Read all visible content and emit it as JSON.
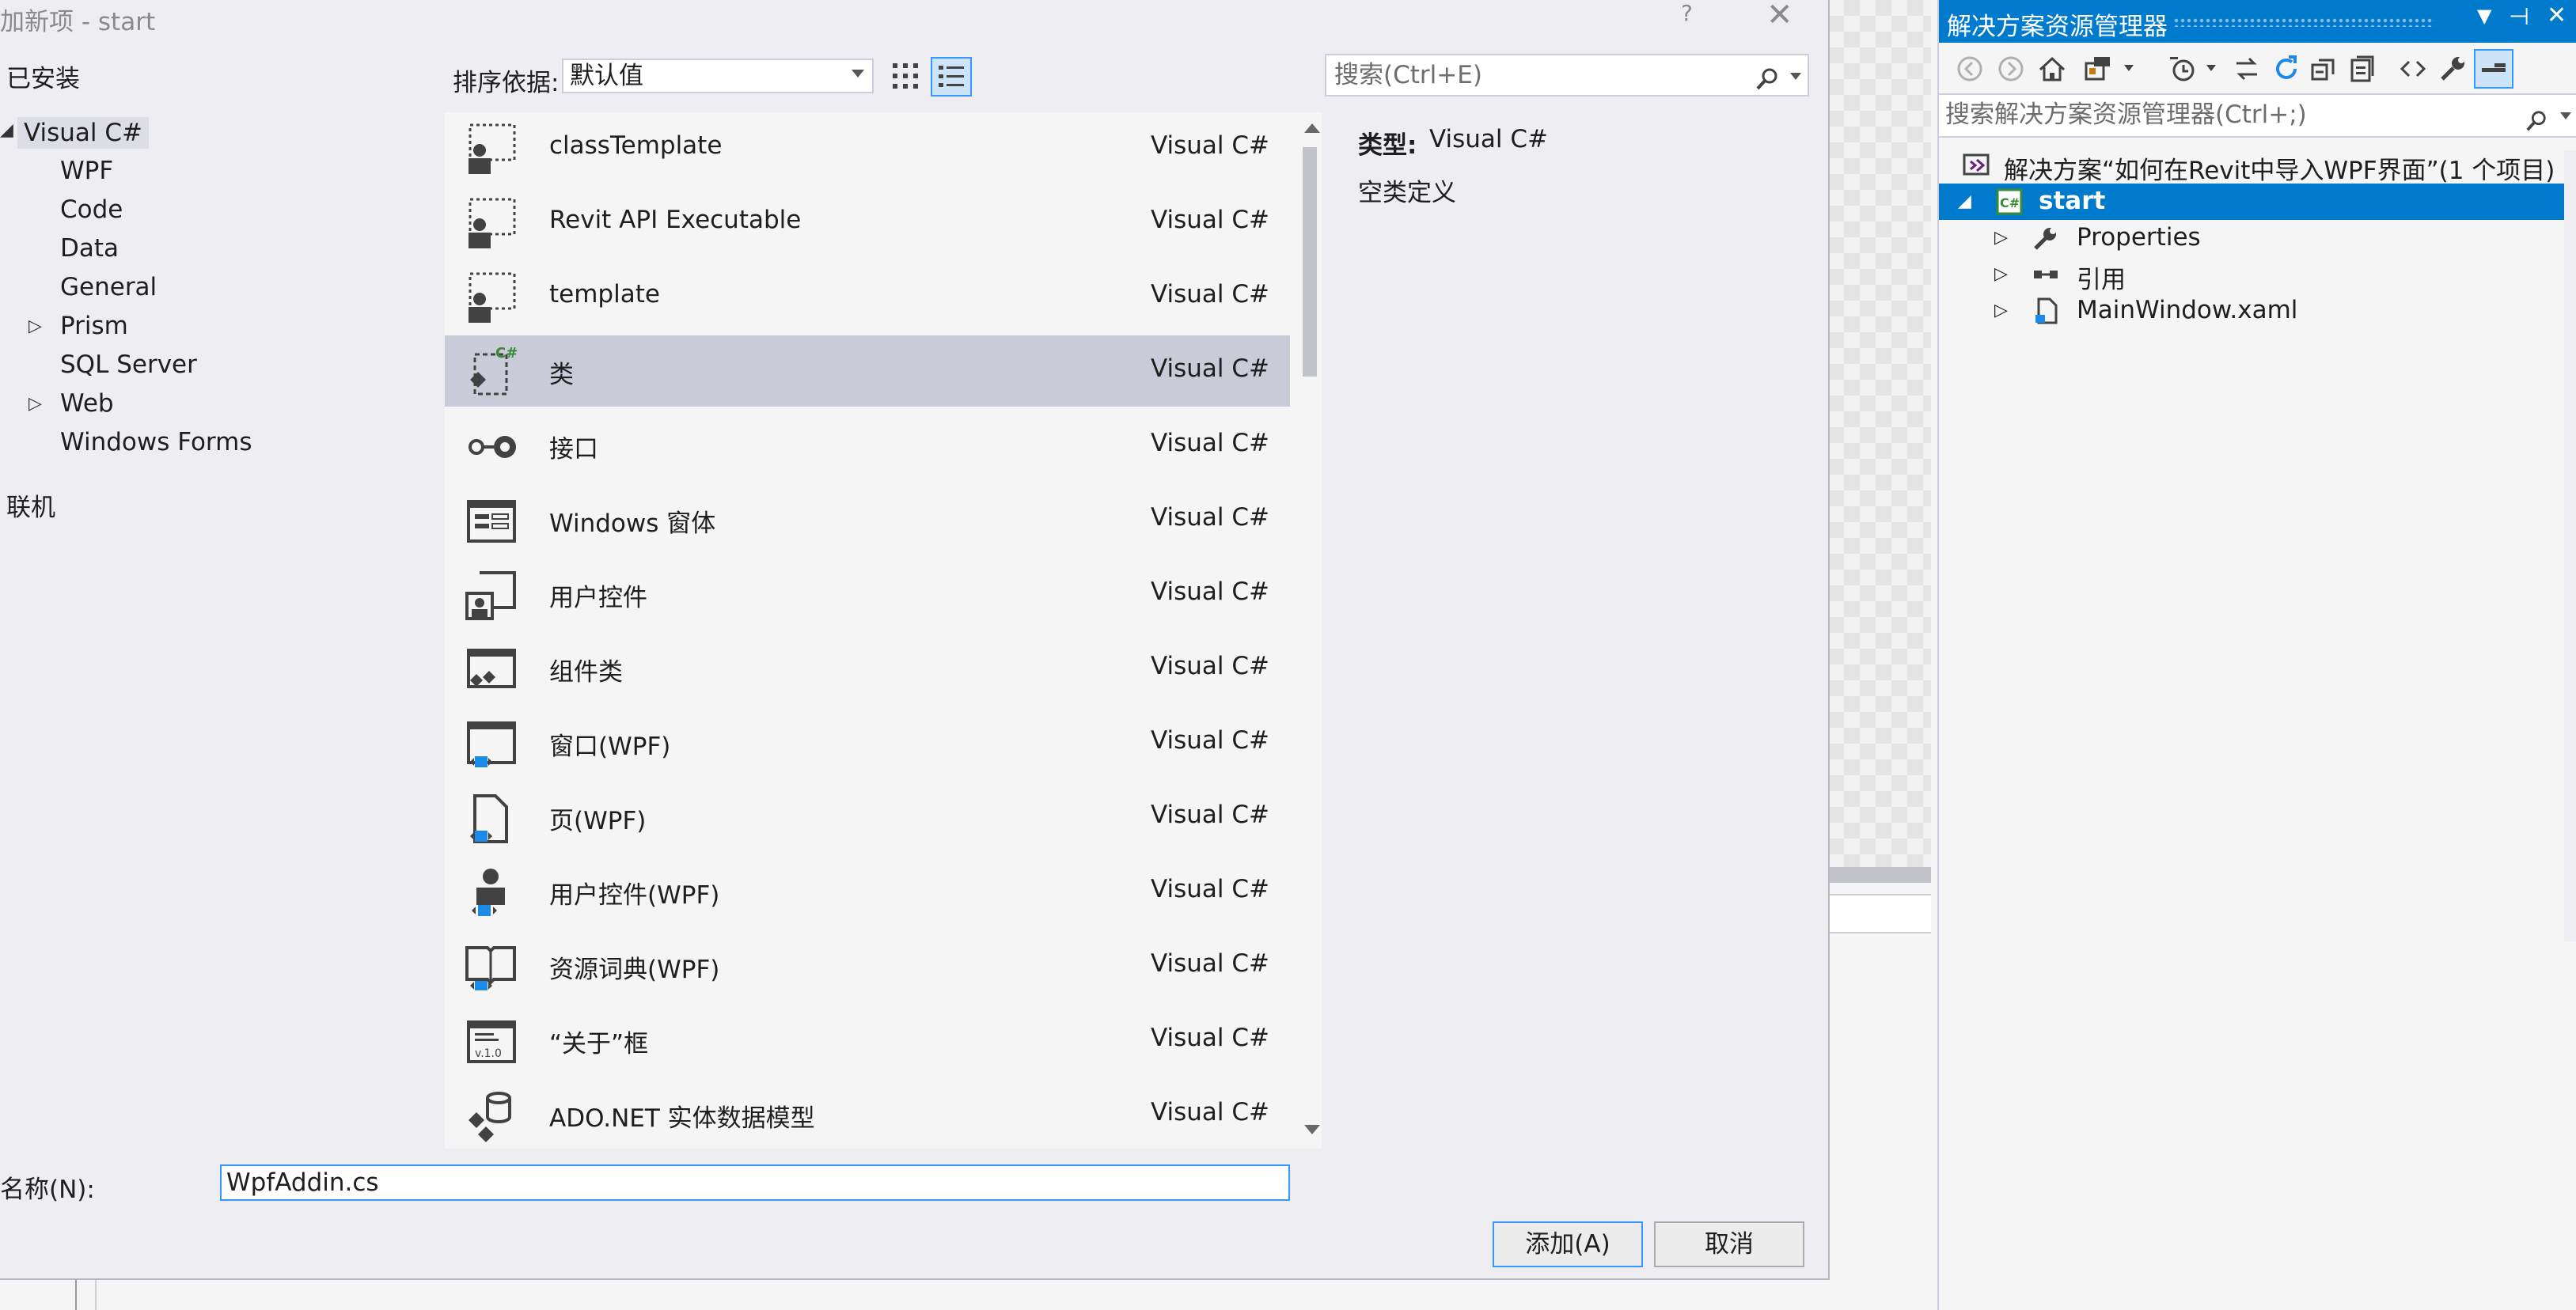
{
  "dialog": {
    "title": "加新项 - start",
    "help": "?",
    "close": "✕",
    "installed": "已安装",
    "tree": {
      "root": "Visual C#",
      "items": [
        "WPF",
        "Code",
        "Data",
        "General",
        "Prism",
        "SQL Server",
        "Web",
        "Windows Forms"
      ],
      "online": "联机"
    },
    "sort_label": "排序依据:",
    "sort_value": "默认值",
    "search_placeholder": "搜索(Ctrl+E)",
    "templates": [
      {
        "name": "classTemplate",
        "type": "Visual C#"
      },
      {
        "name": "Revit API Executable",
        "type": "Visual C#"
      },
      {
        "name": "template",
        "type": "Visual C#"
      },
      {
        "name": "类",
        "type": "Visual C#"
      },
      {
        "name": "接口",
        "type": "Visual C#"
      },
      {
        "name": "Windows 窗体",
        "type": "Visual C#"
      },
      {
        "name": "用户控件",
        "type": "Visual C#"
      },
      {
        "name": "组件类",
        "type": "Visual C#"
      },
      {
        "name": "窗口(WPF)",
        "type": "Visual C#"
      },
      {
        "name": "页(WPF)",
        "type": "Visual C#"
      },
      {
        "name": "用户控件(WPF)",
        "type": "Visual C#"
      },
      {
        "name": "资源词典(WPF)",
        "type": "Visual C#"
      },
      {
        "name": "“关于”框",
        "type": "Visual C#"
      },
      {
        "name": "ADO.NET 实体数据模型",
        "type": "Visual C#"
      }
    ],
    "selected_template": 3,
    "detail": {
      "type_label": "类型:",
      "type_value": "Visual C#",
      "description": "空类定义"
    },
    "name_label": "名称(N):",
    "name_value": "WpfAddin.cs",
    "add_label": "添加(A)",
    "cancel_label": "取消"
  },
  "solution_explorer": {
    "title": "解决方案资源管理器",
    "search_placeholder": "搜索解决方案资源管理器(Ctrl+;)",
    "solution": "解决方案“如何在Revit中导入WPF界面”(1 个项目)",
    "project": "start",
    "children": [
      "Properties",
      "引用",
      "MainWindow.xaml"
    ]
  },
  "colors": {
    "accent": "#007acc",
    "selection": "#c9cbd9",
    "focus_border": "#3399ff"
  }
}
